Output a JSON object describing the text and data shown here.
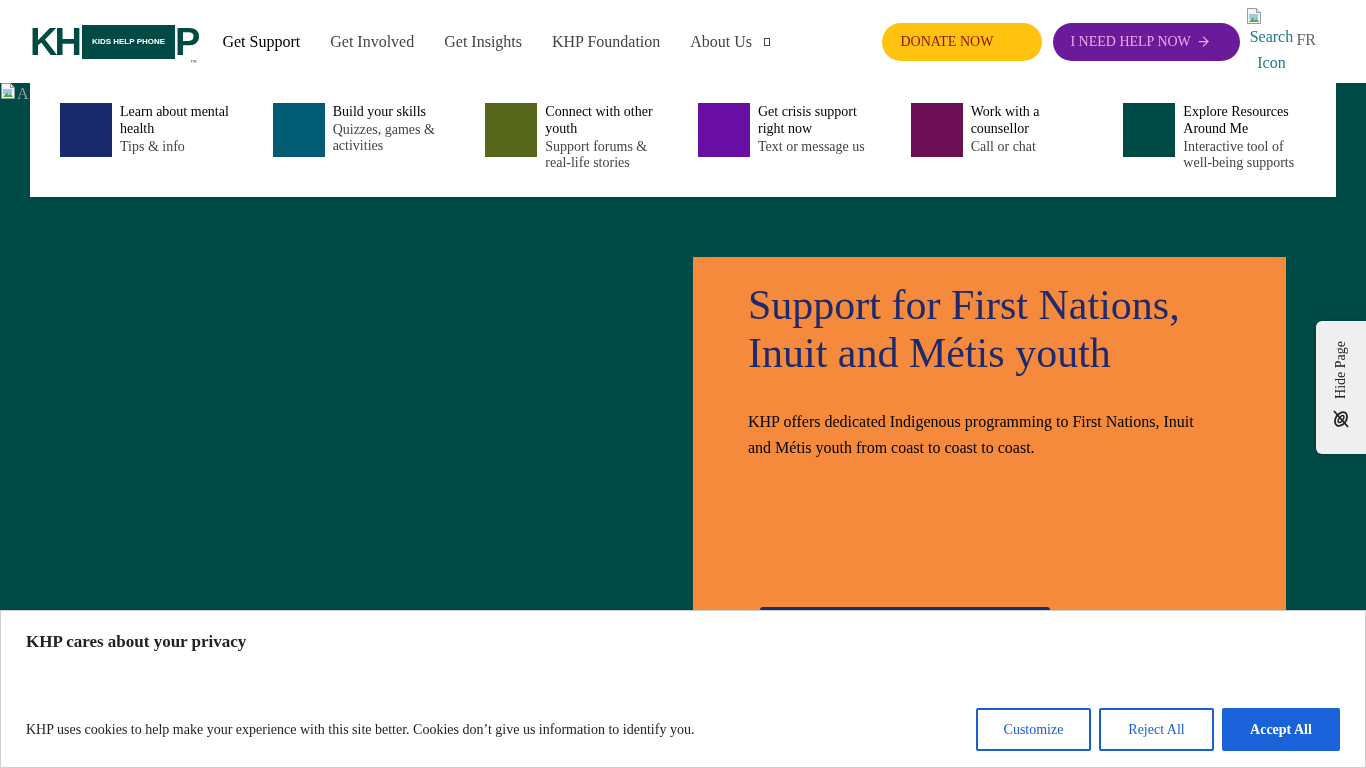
{
  "header": {
    "logo": {
      "letters": "KH",
      "end_letter": "P",
      "tagline": "KIDS HELP PHONE",
      "trademark": "™"
    },
    "nav": [
      {
        "label": "Get Support",
        "selected": true,
        "has_menu": false
      },
      {
        "label": "Get Involved",
        "selected": false,
        "has_menu": false
      },
      {
        "label": "Get Insights",
        "selected": false,
        "has_menu": false
      },
      {
        "label": "KHP Foundation",
        "selected": false,
        "has_menu": false
      },
      {
        "label": "About Us",
        "selected": false,
        "has_menu": true
      }
    ],
    "buttons": [
      {
        "label": "DONATE NOW",
        "kind": "donate"
      },
      {
        "label": "I NEED HELP NOW",
        "kind": "help"
      }
    ],
    "search": {
      "alt_text": "Search Icon"
    },
    "language": "FR"
  },
  "hero_image": {
    "alt_text": "A"
  },
  "quick_links": [
    {
      "title": "Learn about mental health",
      "subtitle": "Tips & info",
      "color": "#182a6c"
    },
    {
      "title": "Build your skills",
      "subtitle": "Quizzes, games & activities",
      "color": "#025c73"
    },
    {
      "title": "Connect with other youth",
      "subtitle": "Support forums & real-life stories",
      "color": "#56661a"
    },
    {
      "title": "Get crisis support right now",
      "subtitle": "Text or message us",
      "color": "#6a0fa3"
    },
    {
      "title": "Work with a counsellor",
      "subtitle": "Call or chat",
      "color": "#6d0f55"
    },
    {
      "title": "Explore Resources Around Me",
      "subtitle": "Interactive tool of well-being supports",
      "color": "#004a45"
    }
  ],
  "hero": {
    "heading": "Support for First Nations, Inuit and Métis youth",
    "body": "KHP offers dedicated Indigenous programming to First Nations, Inuit and Métis youth from coast to coast to coast."
  },
  "hide_page": {
    "label": "Hide Page"
  },
  "cookie_banner": {
    "title": "KHP cares about your privacy",
    "text": "KHP uses cookies to help make your experience with this site better. Cookies don’t give us information to identify you.",
    "buttons": [
      {
        "label": "Customize",
        "kind": "outline"
      },
      {
        "label": "Reject All",
        "kind": "outline"
      },
      {
        "label": "Accept All",
        "kind": "filled"
      }
    ]
  }
}
